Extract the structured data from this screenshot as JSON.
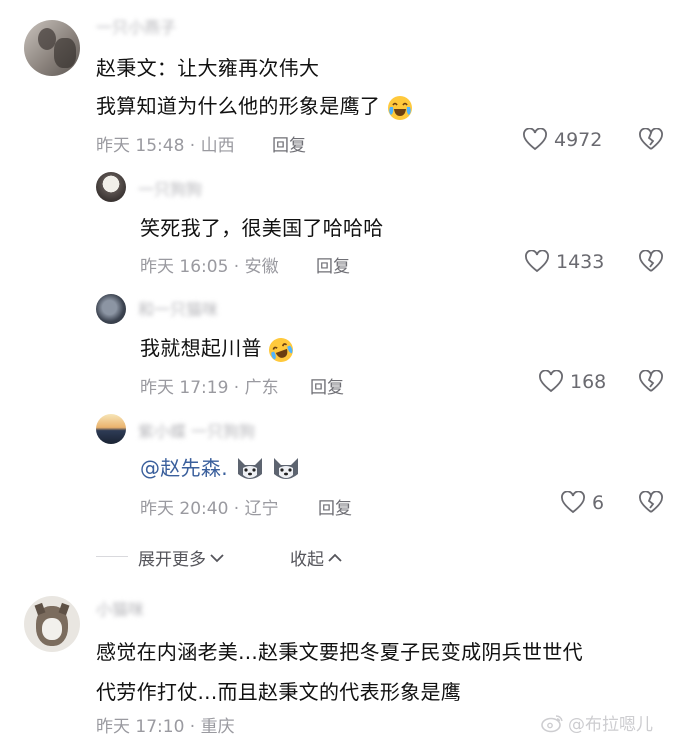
{
  "comments": [
    {
      "author": "一只小燕子",
      "lines": [
        "赵秉文：让大雍再次伟大",
        "我算知道为什么他的形象是鹰了"
      ],
      "time": "昨天 15:48 · 山西",
      "reply": "回复",
      "likes": "4972"
    }
  ],
  "replies": [
    {
      "author": "一只狗狗",
      "text": "笑死我了，很美国了哈哈哈",
      "time": "昨天 16:05 · 安徽",
      "reply": "回复",
      "likes": "1433"
    },
    {
      "author": "和一只猫咪",
      "text": "我就想起川普",
      "time": "昨天 17:19 · 广东",
      "reply": "回复",
      "likes": "168"
    },
    {
      "author": "紫小蝶 一只狗狗",
      "mention": "@赵先森.",
      "time": "昨天 20:40 · 辽宁",
      "reply": "回复",
      "likes": "6"
    }
  ],
  "controls": {
    "expand": "展开更多",
    "collapse": "收起"
  },
  "last_comment": {
    "author": "小猫咪",
    "lines": [
      "感觉在内涵老美...赵秉文要把冬夏子民变成阴兵世世代",
      "代劳作打仗...而且赵秉文的代表形象是鹰"
    ],
    "time": "昨天 17:10 · 重庆"
  },
  "watermark": "@布拉嗯儿",
  "icons": [
    "heart-icon",
    "broken-heart-icon",
    "chevron-down-icon",
    "chevron-up-icon",
    "laugh-cry-emoji",
    "husky-emoji"
  ],
  "colors": {
    "mention": "#3a5f9c",
    "meta": "#9a9aa0",
    "text": "#111111"
  }
}
